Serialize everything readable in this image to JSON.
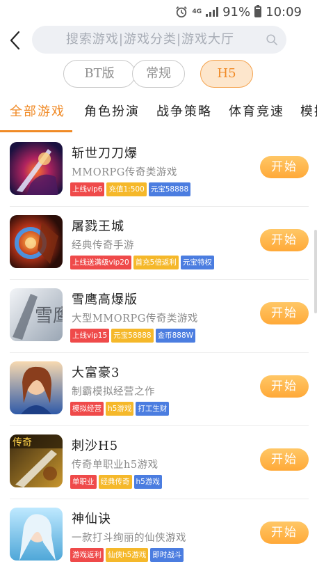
{
  "status_bar": {
    "network": "4G",
    "battery_pct": "91%",
    "time": "10:09"
  },
  "search": {
    "placeholder": "搜索游戏|游戏分类|游戏大厅"
  },
  "version_chips": [
    {
      "label": "BT版"
    },
    {
      "label": "常规"
    },
    {
      "label": "H5",
      "selected": true
    }
  ],
  "category_tabs": [
    {
      "label": "全部游戏",
      "active": true
    },
    {
      "label": "角色扮演"
    },
    {
      "label": "战争策略"
    },
    {
      "label": "体育竞速"
    },
    {
      "label": "模拟"
    }
  ],
  "colors": {
    "accent": "#f08a26",
    "tag_red": "#ef4a4a",
    "tag_yellow": "#f5b82a",
    "tag_blue": "#4b7de0",
    "button_top": "#ffc766",
    "button_bottom": "#ffa938"
  },
  "games": [
    {
      "name": "斩世刀刀爆",
      "desc": "MMORPG传奇类游戏",
      "tags": [
        {
          "text": "上线vip6",
          "color": "red"
        },
        {
          "text": "充值1:500",
          "color": "yellow"
        },
        {
          "text": "元宝58888",
          "color": "blue"
        }
      ],
      "button": "开始"
    },
    {
      "name": "屠戮王城",
      "desc": "经典传奇手游",
      "tags": [
        {
          "text": "上线送满级vip20",
          "color": "red"
        },
        {
          "text": "首充5倍返利",
          "color": "yellow"
        },
        {
          "text": "元宝特权",
          "color": "blue"
        }
      ],
      "button": "开始"
    },
    {
      "name": "雪鹰高爆版",
      "desc": "大型MMORPG传奇类游戏",
      "tags": [
        {
          "text": "上线vip15",
          "color": "red"
        },
        {
          "text": "元宝58888",
          "color": "yellow"
        },
        {
          "text": "金币888W",
          "color": "blue"
        }
      ],
      "button": "开始"
    },
    {
      "name": "大富豪3",
      "desc": "制霸模拟经营之作",
      "tags": [
        {
          "text": "模拟经营",
          "color": "red"
        },
        {
          "text": "h5游戏",
          "color": "yellow"
        },
        {
          "text": "打工生财",
          "color": "blue"
        }
      ],
      "button": "开始"
    },
    {
      "name": "刺沙H5",
      "desc": "传奇单职业h5游戏",
      "tags": [
        {
          "text": "单职业",
          "color": "red"
        },
        {
          "text": "经典传奇",
          "color": "yellow"
        },
        {
          "text": "h5游戏",
          "color": "blue"
        }
      ],
      "button": "开始"
    },
    {
      "name": "神仙诀",
      "desc": "一款打斗绚丽的仙侠游戏",
      "tags": [
        {
          "text": "游戏返利",
          "color": "red"
        },
        {
          "text": "仙侠h5游戏",
          "color": "yellow"
        },
        {
          "text": "即时战斗",
          "color": "blue"
        }
      ],
      "button": "开始"
    }
  ],
  "icon_art": {
    "game_3_calligraphy": "雪鹰",
    "game_5_badge": "传奇"
  }
}
